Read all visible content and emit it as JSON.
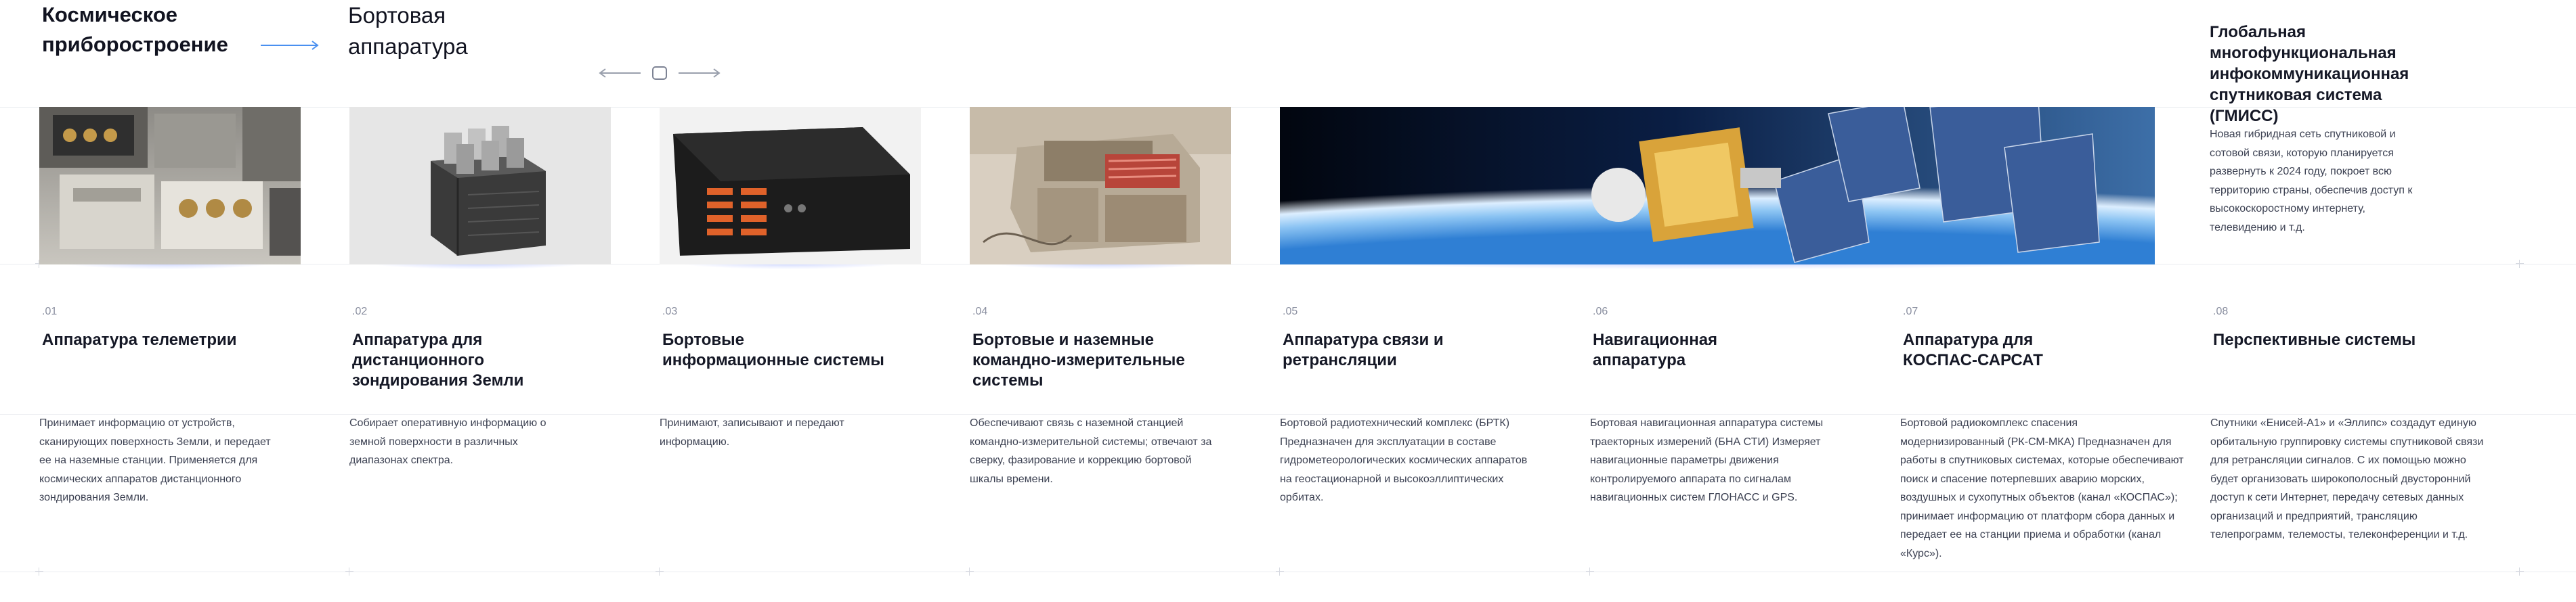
{
  "header": {
    "brand": "Космическое приборостроение",
    "breadcrumb": "Бортовая аппаратура"
  },
  "featured": {
    "title": "Глобальная многофункциональная инфокоммуникационная спутниковая система (ГМИСС)",
    "description": "Новая гибридная сеть спутниковой и сотовой связи, которую планируется развернуть к 2024 году, покроет всю территорию страны, обеспечив доступ к высокоскоростному интернету, телевидению и т.д."
  },
  "items": [
    {
      "num": ".01",
      "title": "Аппаратура телеметрии",
      "desc": "Принимает информацию от устройств, сканирующих поверхность Земли, и передает ее на наземные станции. Применяется для космических аппаратов дистанционного зондирования Земли."
    },
    {
      "num": ".02",
      "title": "Аппаратура для дистанционного зондирования Земли",
      "desc": "Собирает оперативную информацию о земной поверхности в различных диапазонах спектра."
    },
    {
      "num": ".03",
      "title": "Бортовые информационные системы",
      "desc": "Принимают, записывают и передают информацию."
    },
    {
      "num": ".04",
      "title": "Бортовые и наземные командно-измерительные системы",
      "desc": "Обеспечивают связь с наземной станцией командно-измерительной системы; отвечают за сверку, фазирование и коррекцию бортовой шкалы времени."
    },
    {
      "num": ".05",
      "title": "Аппаратура связи и ретрансляции",
      "desc": "Бортовой радиотехнический комплекс (БРТК) Предназначен для эксплуатации в составе гидрометеорологических космических аппаратов на геостационарной и высокоэллиптических орбитах."
    },
    {
      "num": ".06",
      "title": "Навигационная аппаратура",
      "desc": "Бортовая навигационная аппаратура системы траекторных измерений (БНА СТИ) Измеряет навигационные параметры движения контролируемого аппарата по сигналам навигационных систем ГЛОНАСС и GPS."
    },
    {
      "num": ".07",
      "title": "Аппаратура для КОСПАС-САРСАТ",
      "desc": "Бортовой радиокомплекс спасения модернизированный (РК-СМ-МКА) Предназначен для работы в спутниковых системах, которые обеспечивают поиск и спасение потерпевших аварию морских, воздушных и сухопутных объектов (канал «КОСПАС»); принимает информацию от платформ сбора данных и передает ее на станции приема и обработки (канал «Курс»)."
    },
    {
      "num": ".08",
      "title": "Перспективные системы",
      "desc": "Спутники «Енисей-А1» и «Эллипс» создадут единую орбитальную группировку системы спутниковой связи для ретрансляции сигналов. С их помощью можно будет организовать широкополосный двусторонний доступ к сети Интернет, передачу сетевых данных организаций и предприятий, трансляцию телепрограмм, телемосты, телеконференции и т.д."
    }
  ],
  "colors": {
    "accent": "#3f8df0",
    "text": "#151826",
    "muted": "#8a8fa0"
  }
}
